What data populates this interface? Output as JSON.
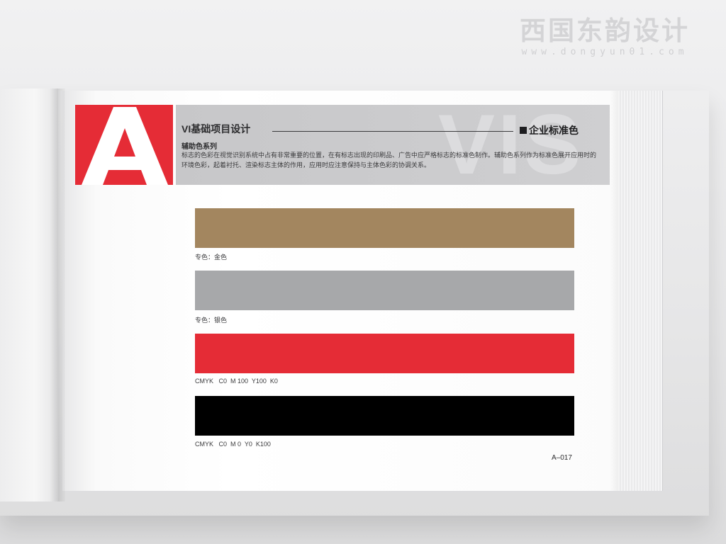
{
  "watermark": {
    "title": "西国东韵设计",
    "url": "www.dongyun01.com"
  },
  "header": {
    "logo_letter": "A",
    "vi_title": "VI基础项目设计",
    "section_name": "企业标准色",
    "background_text": "VIS",
    "sub_title": "辅助色系列",
    "description": "标志的色彩在视觉识别系统中占有非常重要的位置，在有标志出现的印刷品、广告中应严格标志的标准色制作。辅助色系列作为标准色展开应用时的环境色彩，起着衬托、渲染标志主体的作用，应用时应注意保持与主体色彩的协调关系。"
  },
  "swatches": [
    {
      "label": "专色：金色",
      "color": "#a3865f"
    },
    {
      "label": "专色：银色",
      "color": "#a7a8aa"
    },
    {
      "label": "CMYK   C0  M 100  Y100  K0",
      "color": "#e52c36"
    },
    {
      "label": "CMYK   C0  M 0  Y0  K100",
      "color": "#000000"
    }
  ],
  "page_number": "A–017",
  "colors": {
    "logo_red": "#e52c36",
    "header_gray": "#c9c9cb"
  }
}
